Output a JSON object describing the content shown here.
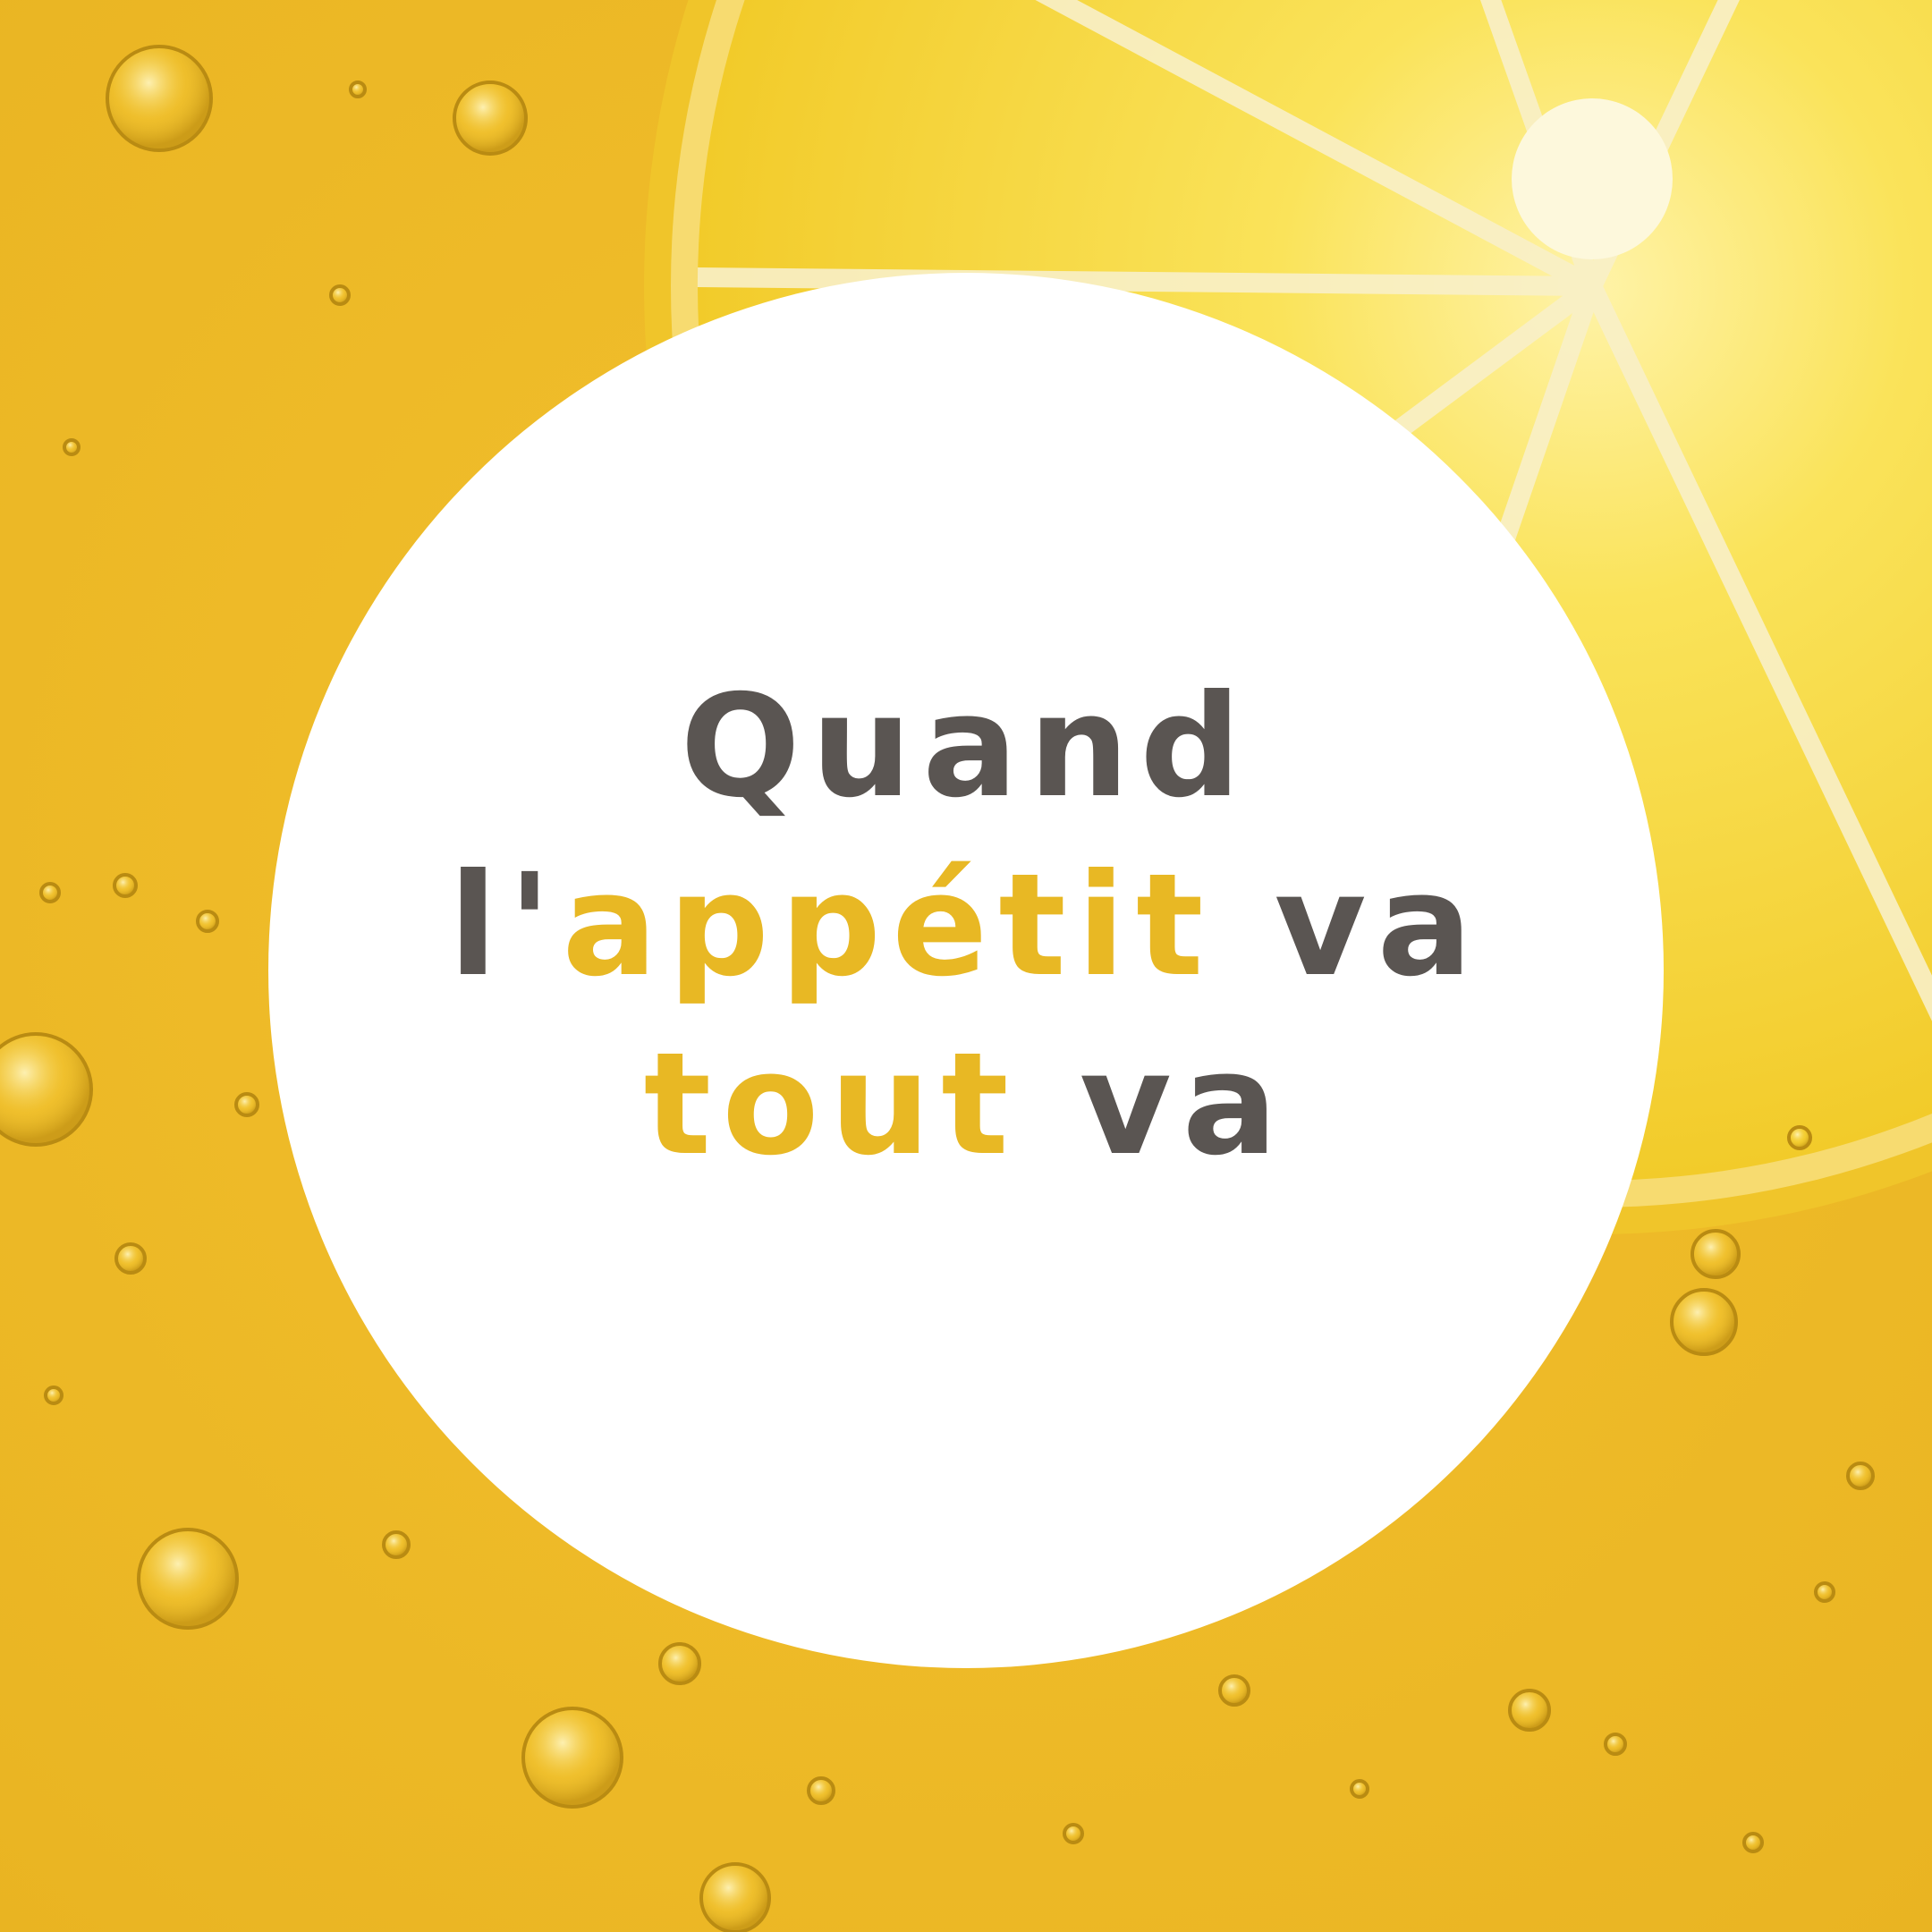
{
  "colors": {
    "background": "#efbd2a",
    "lemon": "#f7dc3c",
    "pith": "#fbf3c4",
    "circle": "#ffffff",
    "text_dark": "#5a5552",
    "text_accent": "#e8b824"
  },
  "headline": {
    "line1": {
      "word1": "Quand"
    },
    "line2": {
      "prefix": "l'",
      "accent": "appétit",
      "suffix": " va"
    },
    "line3": {
      "accent": "tout",
      "suffix": " va"
    }
  }
}
